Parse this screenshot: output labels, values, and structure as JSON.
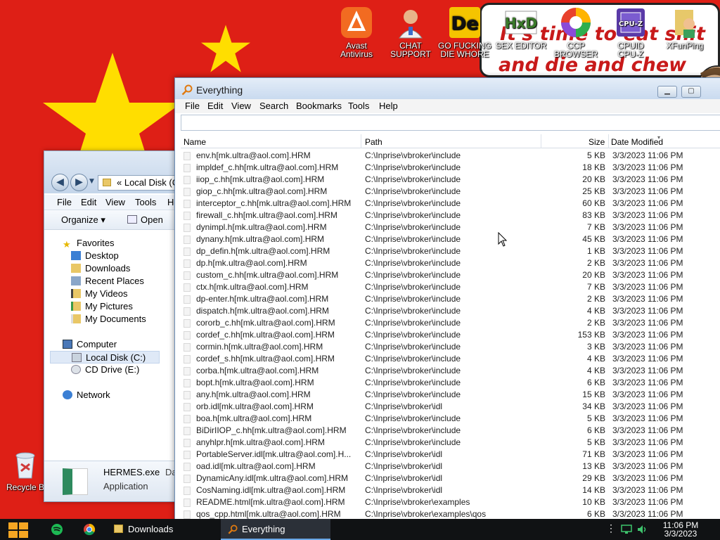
{
  "desktop": {
    "icons": [
      {
        "line1": "Avast",
        "line2": "Antivirus"
      },
      {
        "line1": "CHAT",
        "line2": "SUPPORT"
      },
      {
        "line1": "GO FUCKING",
        "line2": "DIE WHORE"
      },
      {
        "line1": "SEX EDITOR",
        "line2": ""
      },
      {
        "line1": "CCP",
        "line2": "BROWSER"
      },
      {
        "line1": "CPUID",
        "line2": "CPU-Z"
      },
      {
        "line1": "XFunPing",
        "line2": ""
      },
      {
        "line1": "Recycle B",
        "line2": ""
      }
    ],
    "sign": {
      "line1": "It's time to eat shit",
      "line2": "and die and chew"
    }
  },
  "explorer": {
    "address": "« Local Disk (C",
    "menu": [
      "File",
      "Edit",
      "View",
      "Tools",
      "He"
    ],
    "toolbar": {
      "organize": "Organize ▾",
      "open": "Open"
    },
    "tree": {
      "favorites": "Favorites",
      "desktop": "Desktop",
      "downloads": "Downloads",
      "recent": "Recent Places",
      "videos": "My Videos",
      "pictures": "My Pictures",
      "documents": "My Documents",
      "computer": "Computer",
      "local_disk": "Local Disk (C:)",
      "cd_drive": "CD Drive (E:)",
      "network": "Network"
    },
    "details": {
      "name": "HERMES.exe",
      "extra": "Da",
      "type": "Application"
    }
  },
  "everything": {
    "title": "Everything",
    "menu": [
      "File",
      "Edit",
      "View",
      "Search",
      "Bookmarks",
      "Tools",
      "Help"
    ],
    "search_value": "",
    "columns": {
      "name": "Name",
      "path": "Path",
      "size": "Size",
      "date": "Date Modified"
    },
    "rows": [
      {
        "name": "env.h[mk.ultra@aol.com].HRM",
        "path": "C:\\Inprise\\vbroker\\include",
        "size": "5 KB",
        "date": "3/3/2023 11:06 PM"
      },
      {
        "name": "impldef_c.hh[mk.ultra@aol.com].HRM",
        "path": "C:\\Inprise\\vbroker\\include",
        "size": "18 KB",
        "date": "3/3/2023 11:06 PM"
      },
      {
        "name": "iiop_c.hh[mk.ultra@aol.com].HRM",
        "path": "C:\\Inprise\\vbroker\\include",
        "size": "20 KB",
        "date": "3/3/2023 11:06 PM"
      },
      {
        "name": "giop_c.hh[mk.ultra@aol.com].HRM",
        "path": "C:\\Inprise\\vbroker\\include",
        "size": "25 KB",
        "date": "3/3/2023 11:06 PM"
      },
      {
        "name": "interceptor_c.hh[mk.ultra@aol.com].HRM",
        "path": "C:\\Inprise\\vbroker\\include",
        "size": "60 KB",
        "date": "3/3/2023 11:06 PM"
      },
      {
        "name": "firewall_c.hh[mk.ultra@aol.com].HRM",
        "path": "C:\\Inprise\\vbroker\\include",
        "size": "83 KB",
        "date": "3/3/2023 11:06 PM"
      },
      {
        "name": "dynimpl.h[mk.ultra@aol.com].HRM",
        "path": "C:\\Inprise\\vbroker\\include",
        "size": "7 KB",
        "date": "3/3/2023 11:06 PM"
      },
      {
        "name": "dynany.h[mk.ultra@aol.com].HRM",
        "path": "C:\\Inprise\\vbroker\\include",
        "size": "45 KB",
        "date": "3/3/2023 11:06 PM"
      },
      {
        "name": "dp_defin.h[mk.ultra@aol.com].HRM",
        "path": "C:\\Inprise\\vbroker\\include",
        "size": "1 KB",
        "date": "3/3/2023 11:06 PM"
      },
      {
        "name": "dp.h[mk.ultra@aol.com].HRM",
        "path": "C:\\Inprise\\vbroker\\include",
        "size": "2 KB",
        "date": "3/3/2023 11:06 PM"
      },
      {
        "name": "custom_c.hh[mk.ultra@aol.com].HRM",
        "path": "C:\\Inprise\\vbroker\\include",
        "size": "20 KB",
        "date": "3/3/2023 11:06 PM"
      },
      {
        "name": "ctx.h[mk.ultra@aol.com].HRM",
        "path": "C:\\Inprise\\vbroker\\include",
        "size": "7 KB",
        "date": "3/3/2023 11:06 PM"
      },
      {
        "name": "dp-enter.h[mk.ultra@aol.com].HRM",
        "path": "C:\\Inprise\\vbroker\\include",
        "size": "2 KB",
        "date": "3/3/2023 11:06 PM"
      },
      {
        "name": "dispatch.h[mk.ultra@aol.com].HRM",
        "path": "C:\\Inprise\\vbroker\\include",
        "size": "4 KB",
        "date": "3/3/2023 11:06 PM"
      },
      {
        "name": "cororb_c.hh[mk.ultra@aol.com].HRM",
        "path": "C:\\Inprise\\vbroker\\include",
        "size": "2 KB",
        "date": "3/3/2023 11:06 PM"
      },
      {
        "name": "cordef_c.hh[mk.ultra@aol.com].HRM",
        "path": "C:\\Inprise\\vbroker\\include",
        "size": "153 KB",
        "date": "3/3/2023 11:06 PM"
      },
      {
        "name": "cormin.h[mk.ultra@aol.com].HRM",
        "path": "C:\\Inprise\\vbroker\\include",
        "size": "3 KB",
        "date": "3/3/2023 11:06 PM"
      },
      {
        "name": "cordef_s.hh[mk.ultra@aol.com].HRM",
        "path": "C:\\Inprise\\vbroker\\include",
        "size": "4 KB",
        "date": "3/3/2023 11:06 PM"
      },
      {
        "name": "corba.h[mk.ultra@aol.com].HRM",
        "path": "C:\\Inprise\\vbroker\\include",
        "size": "4 KB",
        "date": "3/3/2023 11:06 PM"
      },
      {
        "name": "bopt.h[mk.ultra@aol.com].HRM",
        "path": "C:\\Inprise\\vbroker\\include",
        "size": "6 KB",
        "date": "3/3/2023 11:06 PM"
      },
      {
        "name": "any.h[mk.ultra@aol.com].HRM",
        "path": "C:\\Inprise\\vbroker\\include",
        "size": "15 KB",
        "date": "3/3/2023 11:06 PM"
      },
      {
        "name": "orb.idl[mk.ultra@aol.com].HRM",
        "path": "C:\\Inprise\\vbroker\\idl",
        "size": "34 KB",
        "date": "3/3/2023 11:06 PM"
      },
      {
        "name": "boa.h[mk.ultra@aol.com].HRM",
        "path": "C:\\Inprise\\vbroker\\include",
        "size": "5 KB",
        "date": "3/3/2023 11:06 PM"
      },
      {
        "name": "BiDirIIOP_c.hh[mk.ultra@aol.com].HRM",
        "path": "C:\\Inprise\\vbroker\\include",
        "size": "6 KB",
        "date": "3/3/2023 11:06 PM"
      },
      {
        "name": "anyhlpr.h[mk.ultra@aol.com].HRM",
        "path": "C:\\Inprise\\vbroker\\include",
        "size": "5 KB",
        "date": "3/3/2023 11:06 PM"
      },
      {
        "name": "PortableServer.idl[mk.ultra@aol.com].H...",
        "path": "C:\\Inprise\\vbroker\\idl",
        "size": "71 KB",
        "date": "3/3/2023 11:06 PM"
      },
      {
        "name": "oad.idl[mk.ultra@aol.com].HRM",
        "path": "C:\\Inprise\\vbroker\\idl",
        "size": "13 KB",
        "date": "3/3/2023 11:06 PM"
      },
      {
        "name": "DynamicAny.idl[mk.ultra@aol.com].HRM",
        "path": "C:\\Inprise\\vbroker\\idl",
        "size": "29 KB",
        "date": "3/3/2023 11:06 PM"
      },
      {
        "name": "CosNaming.idl[mk.ultra@aol.com].HRM",
        "path": "C:\\Inprise\\vbroker\\idl",
        "size": "14 KB",
        "date": "3/3/2023 11:06 PM"
      },
      {
        "name": "README.html[mk.ultra@aol.com].HRM",
        "path": "C:\\Inprise\\vbroker\\examples",
        "size": "10 KB",
        "date": "3/3/2023 11:06 PM"
      },
      {
        "name": "qos_cpp.html[mk.ultra@aol.com].HRM",
        "path": "C:\\Inprise\\vbroker\\examples\\qos",
        "size": "6 KB",
        "date": "3/3/2023 11:06 PM"
      }
    ]
  },
  "taskbar": {
    "tasks": [
      {
        "label": "Downloads"
      },
      {
        "label": "Everything"
      }
    ],
    "clock": {
      "time": "11:06 PM",
      "date": "3/3/2023"
    }
  }
}
